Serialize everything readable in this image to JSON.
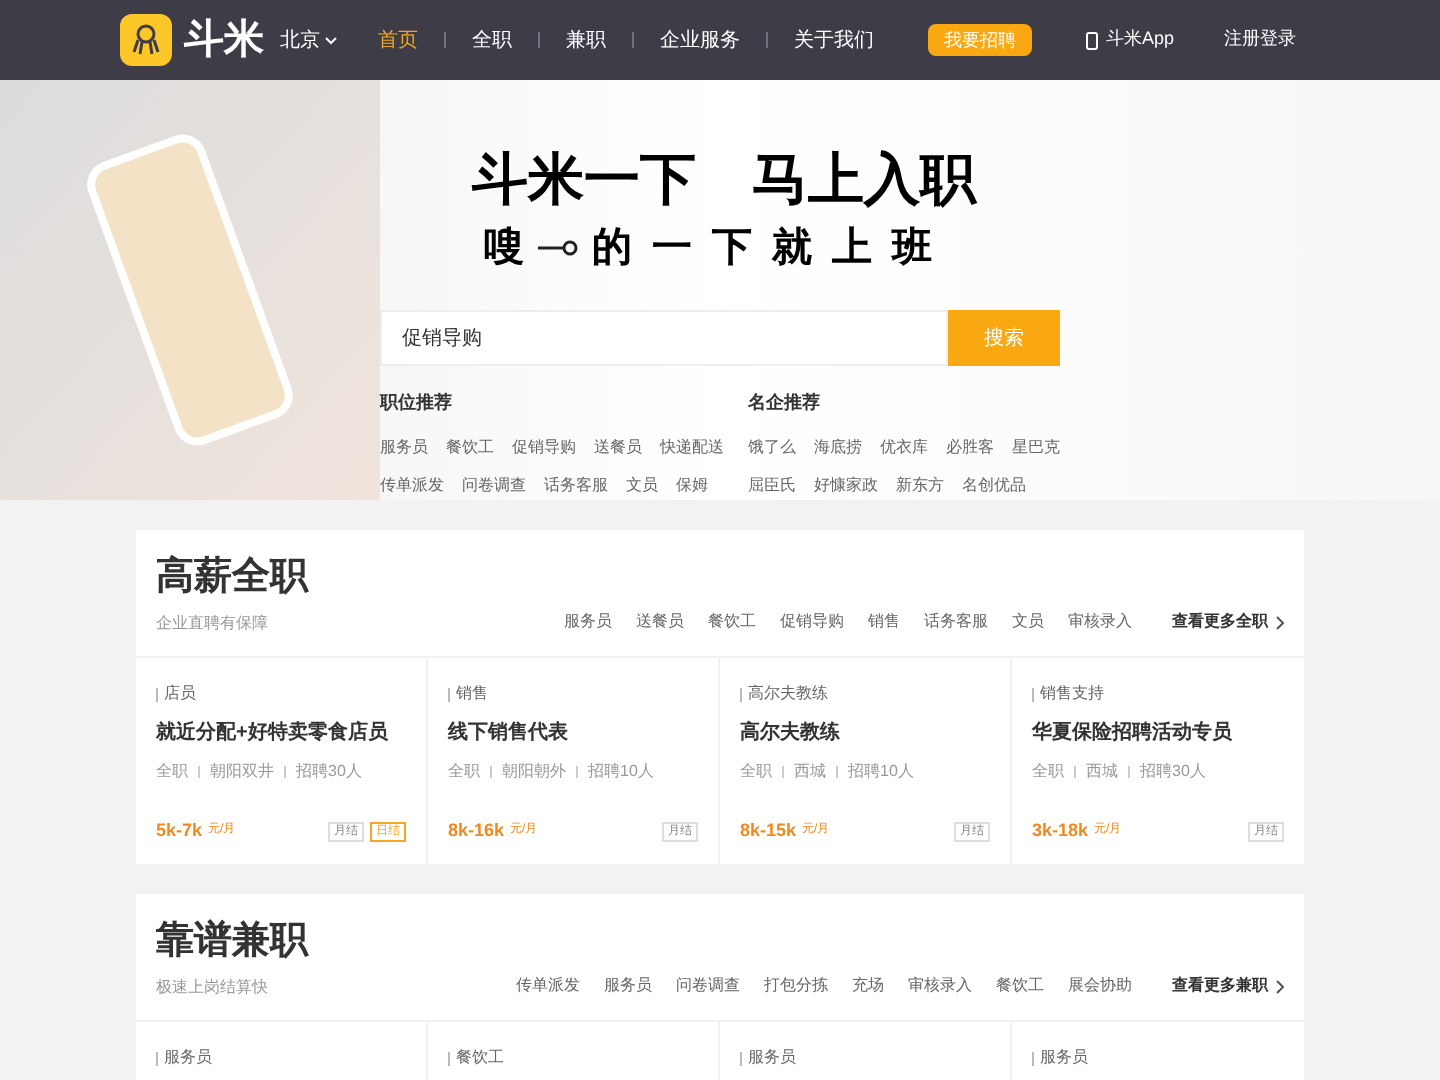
{
  "header": {
    "logo": "斗米",
    "city": "北京",
    "nav": [
      {
        "label": "首页",
        "selected": true
      },
      {
        "label": "全职",
        "selected": false
      },
      {
        "label": "兼职",
        "selected": false
      },
      {
        "label": "企业服务",
        "selected": false
      },
      {
        "label": "关于我们",
        "selected": false
      }
    ],
    "post_button": "我要招聘",
    "app_link": "斗米App",
    "login": "注册登录"
  },
  "hero": {
    "headline": [
      "斗米一下",
      "马上入职"
    ],
    "slogan_start": "嗖",
    "slogan_end": "的一下就上班",
    "search": {
      "value": "促销导购",
      "button": "搜索"
    },
    "groups": [
      {
        "title": "职位推荐",
        "rows": [
          [
            "服务员",
            "餐饮工",
            "促销导购",
            "送餐员",
            "快递配送"
          ],
          [
            "传单派发",
            "问卷调查",
            "话务客服",
            "文员",
            "保姆"
          ]
        ]
      },
      {
        "title": "名企推荐",
        "rows": [
          [
            "饿了么",
            "海底捞",
            "优衣库",
            "必胜客",
            "星巴克"
          ],
          [
            "屈臣氏",
            "好慷家政",
            "新东方",
            "名创优品"
          ]
        ]
      }
    ]
  },
  "sections": [
    {
      "title": "高薪全职",
      "subtitle": "企业直聘有保障",
      "tags": [
        "服务员",
        "送餐员",
        "餐饮工",
        "促销导购",
        "销售",
        "话务客服",
        "文员",
        "审核录入"
      ],
      "more": "查看更多全职",
      "jobs": [
        {
          "category": "店员",
          "title": "就近分配+好特卖零食店员",
          "meta": [
            "全职",
            "朝阳双井",
            "招聘30人"
          ],
          "salary": "5k-7k",
          "unit": "元/月",
          "badges": [
            {
              "text": "月结",
              "kind": "plain"
            },
            {
              "text": "日结",
              "kind": "highlight"
            }
          ]
        },
        {
          "category": "销售",
          "title": "线下销售代表",
          "meta": [
            "全职",
            "朝阳朝外",
            "招聘10人"
          ],
          "salary": "8k-16k",
          "unit": "元/月",
          "badges": [
            {
              "text": "月结",
              "kind": "plain"
            }
          ]
        },
        {
          "category": "高尔夫教练",
          "title": "高尔夫教练",
          "meta": [
            "全职",
            "西城",
            "招聘10人"
          ],
          "salary": "8k-15k",
          "unit": "元/月",
          "badges": [
            {
              "text": "月结",
              "kind": "plain"
            }
          ]
        },
        {
          "category": "销售支持",
          "title": "华夏保险招聘活动专员",
          "meta": [
            "全职",
            "西城",
            "招聘30人"
          ],
          "salary": "3k-18k",
          "unit": "元/月",
          "badges": [
            {
              "text": "月结",
              "kind": "plain"
            }
          ]
        }
      ]
    },
    {
      "title": "靠谱兼职",
      "subtitle": "极速上岗结算快",
      "tags": [
        "传单派发",
        "服务员",
        "问卷调查",
        "打包分拣",
        "充场",
        "审核录入",
        "餐饮工",
        "展会协助"
      ],
      "more": "查看更多兼职",
      "jobs": [
        {
          "category": "服务员"
        },
        {
          "category": "餐饮工"
        },
        {
          "category": "服务员"
        },
        {
          "category": "服务员"
        }
      ]
    }
  ]
}
